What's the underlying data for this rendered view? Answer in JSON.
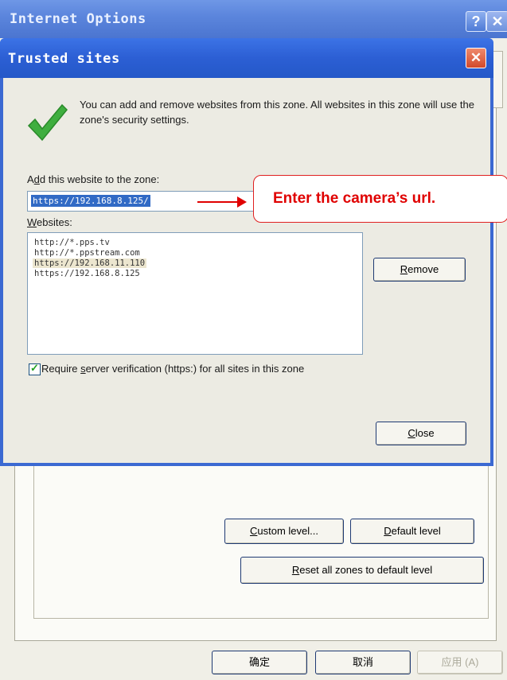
{
  "outer_window": {
    "title": "Internet Options",
    "help_glyph": "?",
    "close_glyph": "✕",
    "custom_level": {
      "pre": "",
      "key": "C",
      "post": "ustom level..."
    },
    "default_level": {
      "pre": "",
      "key": "D",
      "post": "efault level"
    },
    "reset_zones": {
      "pre": "",
      "key": "R",
      "post": "eset all zones to default level"
    },
    "ok_label": "确定",
    "cancel_label": "取消",
    "apply_label": "应用 (A)"
  },
  "dialog": {
    "title": "Trusted sites",
    "close_glyph": "✕",
    "intro": "You can add and remove websites from this zone. All websites in this zone will use the zone's security settings.",
    "add_label": {
      "pre": "A",
      "key": "d",
      "post": "d this website to the zone:"
    },
    "add_value": "https://192.168.8.125/",
    "websites_label": {
      "pre": "",
      "key": "W",
      "post": "ebsites:"
    },
    "websites": [
      {
        "url": "http://*.pps.tv",
        "selected": false
      },
      {
        "url": "http://*.ppstream.com",
        "selected": false
      },
      {
        "url": "https://192.168.11.110",
        "selected": true
      },
      {
        "url": "https://192.168.8.125",
        "selected": false
      }
    ],
    "remove_label": {
      "pre": "",
      "key": "R",
      "post": "emove"
    },
    "require_https": {
      "checked": true,
      "pre": "Require ",
      "key": "s",
      "post": "erver verification (https:) for all sites in this zone"
    },
    "close_label": {
      "pre": "",
      "key": "C",
      "post": "lose"
    }
  },
  "annotation": {
    "text": "Enter the camera’s url.",
    "color": "#e00000"
  }
}
